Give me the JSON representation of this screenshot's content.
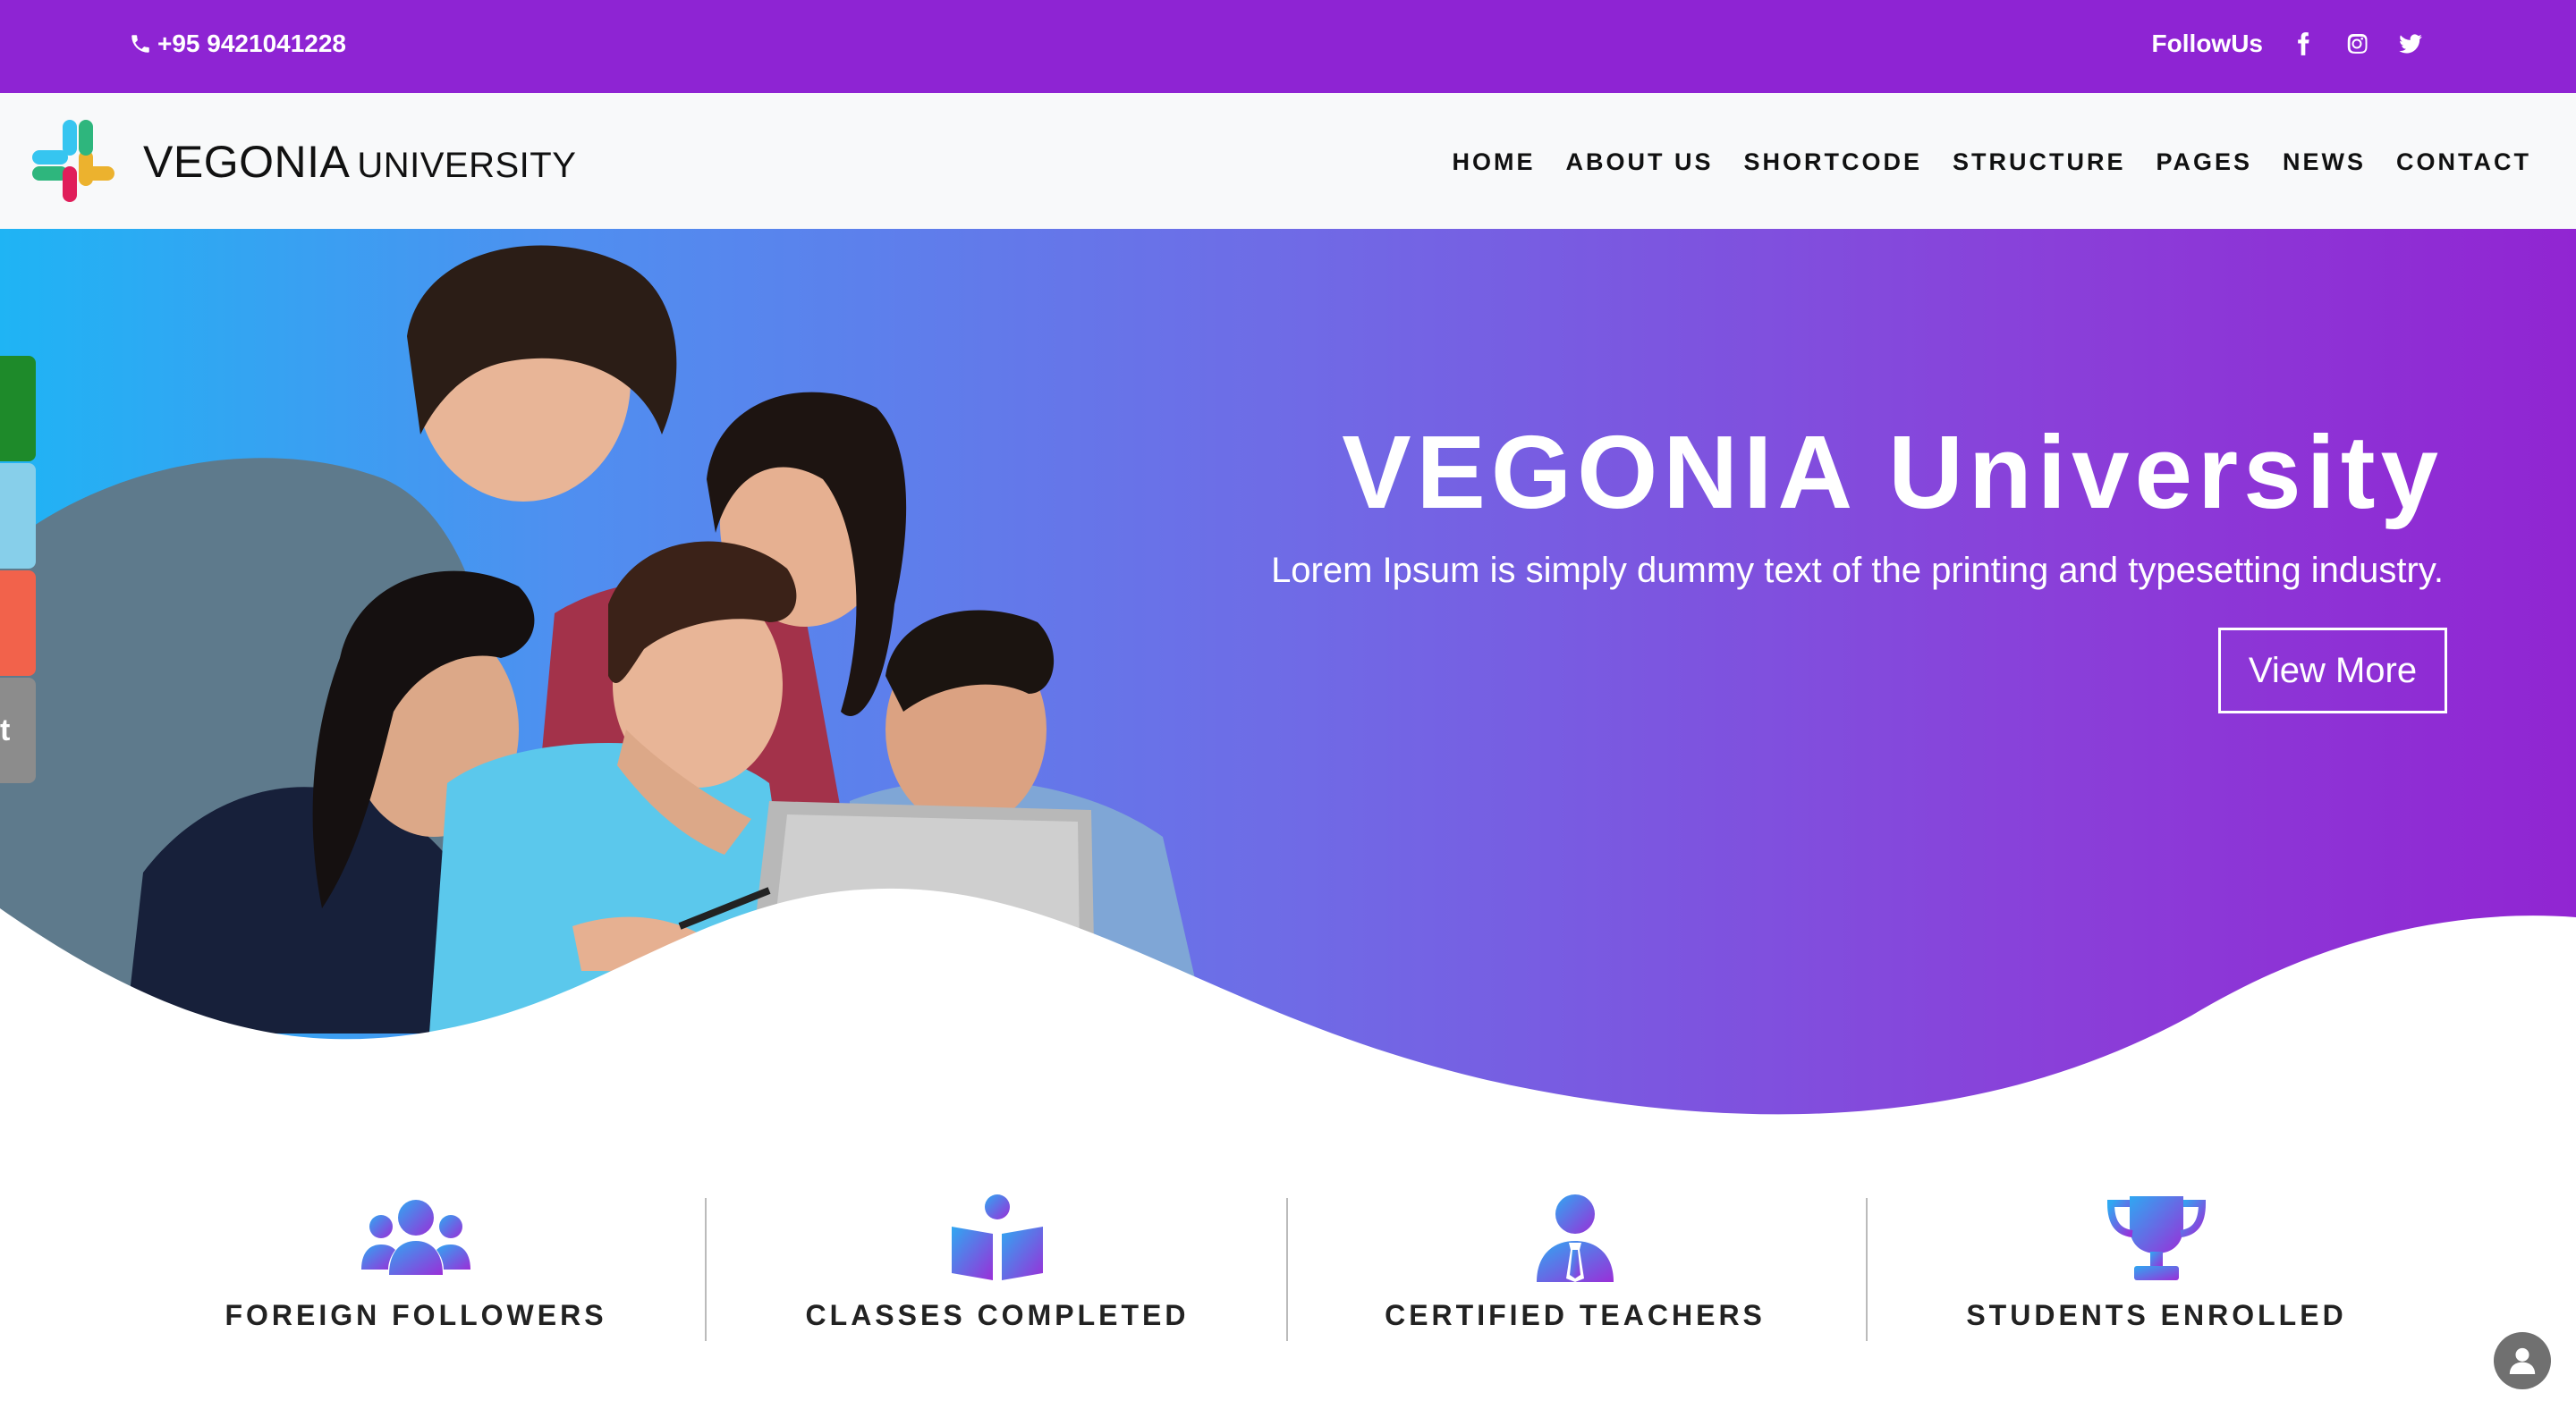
{
  "topbar": {
    "phone": "+95 9421041228",
    "follow_label": "FollowUs",
    "social_icons": [
      "facebook-icon",
      "instagram-icon",
      "twitter-icon"
    ]
  },
  "navbar": {
    "brand_main": "VEGONIA",
    "brand_sub": "UNIVERSITY",
    "menu": [
      "HOME",
      "ABOUT US",
      "SHORTCODE",
      "STRUCTURE",
      "PAGES",
      "NEWS",
      "CONTACT"
    ]
  },
  "hero": {
    "title": "VEGONIA University",
    "subtitle": "Lorem Ipsum is simply dummy text of the printing and typesetting industry.",
    "button": "View More"
  },
  "side_tabs": [
    "",
    "",
    "",
    "t"
  ],
  "features": [
    {
      "label": "FOREIGN FOLLOWERS",
      "icon": "users-icon"
    },
    {
      "label": "CLASSES COMPLETED",
      "icon": "book-icon"
    },
    {
      "label": "CERTIFIED TEACHERS",
      "icon": "teacher-icon"
    },
    {
      "label": "STUDENTS ENROLLED",
      "icon": "trophy-icon"
    }
  ],
  "colors": {
    "topbar": "#8e24d3",
    "gradient_start": "#1fb4f4",
    "gradient_end": "#9125d2",
    "text_dark": "#111111"
  }
}
